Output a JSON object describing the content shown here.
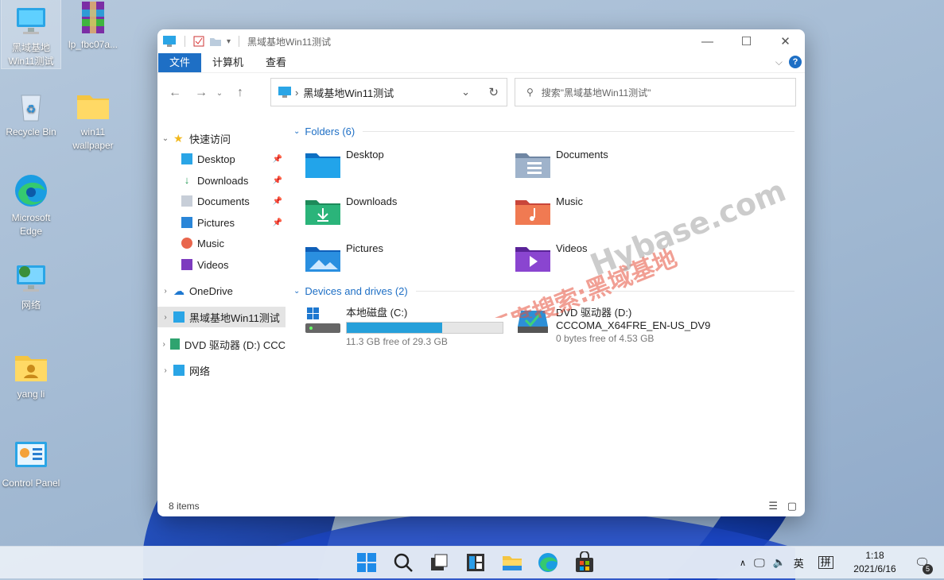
{
  "desktop": {
    "icons": [
      {
        "label": "黑域基地Win11测试",
        "icon": "computer-icon"
      },
      {
        "label": "lp_fbc07a...",
        "icon": "winrar-archive-icon"
      },
      {
        "label": "Recycle Bin",
        "icon": "recycle-bin-icon"
      },
      {
        "label": "win11 wallpaper",
        "icon": "folder-icon"
      },
      {
        "label": "Microsoft Edge",
        "icon": "edge-icon"
      },
      {
        "label": "网络",
        "icon": "network-icon"
      },
      {
        "label": "yang li",
        "icon": "user-folder-icon"
      },
      {
        "label": "Control Panel",
        "icon": "control-panel-icon"
      }
    ]
  },
  "window": {
    "title": "黑域基地Win11测试",
    "ribbon_tabs": [
      "文件",
      "计算机",
      "查看"
    ],
    "help_label": "?",
    "address": "黑域基地Win11测试",
    "search_placeholder": "搜索\"黑域基地Win11测试\"",
    "nav": {
      "quick_access": "快速访问",
      "quick_items": [
        "Desktop",
        "Downloads",
        "Documents",
        "Pictures",
        "Music",
        "Videos"
      ],
      "onedrive": "OneDrive",
      "this_pc": "黑域基地Win11测试",
      "dvd": "DVD 驱动器 (D:) CCC",
      "network": "网络"
    },
    "folders_header": "Folders (6)",
    "folders": [
      "Desktop",
      "Documents",
      "Downloads",
      "Music",
      "Pictures",
      "Videos"
    ],
    "drives_header": "Devices and drives (2)",
    "drives": [
      {
        "name": "本地磁盘 (C:)",
        "free": "11.3 GB free of 29.3 GB",
        "used_fraction": 0.61
      },
      {
        "name": "DVD 驱动器 (D:)",
        "label": "CCCOMA_X64FRE_EN-US_DV9",
        "free": "0 bytes free of 4.53 GB"
      }
    ],
    "status": "8 items"
  },
  "watermark": {
    "line1": "百度搜索:黑域基地",
    "line2": "Hybase.com"
  },
  "taskbar": {
    "ime": "英",
    "ime2": "拼",
    "time": "1:18",
    "date": "2021/6/16",
    "notif_count": "5"
  }
}
